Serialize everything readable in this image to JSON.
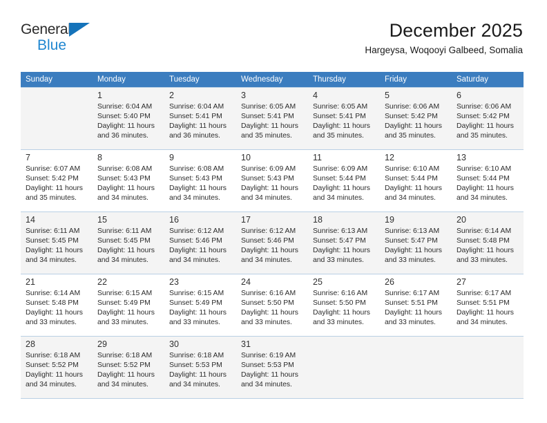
{
  "brand": {
    "name_part1": "General",
    "name_part2": "Blue",
    "accent_color": "#1f86d0",
    "triangle_color": "#1573ba"
  },
  "header": {
    "title": "December 2025",
    "subtitle": "Hargeysa, Woqooyi Galbeed, Somalia"
  },
  "calendar": {
    "header_bg": "#3b7dbf",
    "weekdays": [
      "Sunday",
      "Monday",
      "Tuesday",
      "Wednesday",
      "Thursday",
      "Friday",
      "Saturday"
    ],
    "weeks": [
      [
        {
          "day": "",
          "sunrise": "",
          "sunset": "",
          "daylight_line1": "",
          "daylight_line2": ""
        },
        {
          "day": "1",
          "sunrise": "Sunrise: 6:04 AM",
          "sunset": "Sunset: 5:40 PM",
          "daylight_line1": "Daylight: 11 hours",
          "daylight_line2": "and 36 minutes."
        },
        {
          "day": "2",
          "sunrise": "Sunrise: 6:04 AM",
          "sunset": "Sunset: 5:41 PM",
          "daylight_line1": "Daylight: 11 hours",
          "daylight_line2": "and 36 minutes."
        },
        {
          "day": "3",
          "sunrise": "Sunrise: 6:05 AM",
          "sunset": "Sunset: 5:41 PM",
          "daylight_line1": "Daylight: 11 hours",
          "daylight_line2": "and 35 minutes."
        },
        {
          "day": "4",
          "sunrise": "Sunrise: 6:05 AM",
          "sunset": "Sunset: 5:41 PM",
          "daylight_line1": "Daylight: 11 hours",
          "daylight_line2": "and 35 minutes."
        },
        {
          "day": "5",
          "sunrise": "Sunrise: 6:06 AM",
          "sunset": "Sunset: 5:42 PM",
          "daylight_line1": "Daylight: 11 hours",
          "daylight_line2": "and 35 minutes."
        },
        {
          "day": "6",
          "sunrise": "Sunrise: 6:06 AM",
          "sunset": "Sunset: 5:42 PM",
          "daylight_line1": "Daylight: 11 hours",
          "daylight_line2": "and 35 minutes."
        }
      ],
      [
        {
          "day": "7",
          "sunrise": "Sunrise: 6:07 AM",
          "sunset": "Sunset: 5:42 PM",
          "daylight_line1": "Daylight: 11 hours",
          "daylight_line2": "and 35 minutes."
        },
        {
          "day": "8",
          "sunrise": "Sunrise: 6:08 AM",
          "sunset": "Sunset: 5:43 PM",
          "daylight_line1": "Daylight: 11 hours",
          "daylight_line2": "and 34 minutes."
        },
        {
          "day": "9",
          "sunrise": "Sunrise: 6:08 AM",
          "sunset": "Sunset: 5:43 PM",
          "daylight_line1": "Daylight: 11 hours",
          "daylight_line2": "and 34 minutes."
        },
        {
          "day": "10",
          "sunrise": "Sunrise: 6:09 AM",
          "sunset": "Sunset: 5:43 PM",
          "daylight_line1": "Daylight: 11 hours",
          "daylight_line2": "and 34 minutes."
        },
        {
          "day": "11",
          "sunrise": "Sunrise: 6:09 AM",
          "sunset": "Sunset: 5:44 PM",
          "daylight_line1": "Daylight: 11 hours",
          "daylight_line2": "and 34 minutes."
        },
        {
          "day": "12",
          "sunrise": "Sunrise: 6:10 AM",
          "sunset": "Sunset: 5:44 PM",
          "daylight_line1": "Daylight: 11 hours",
          "daylight_line2": "and 34 minutes."
        },
        {
          "day": "13",
          "sunrise": "Sunrise: 6:10 AM",
          "sunset": "Sunset: 5:44 PM",
          "daylight_line1": "Daylight: 11 hours",
          "daylight_line2": "and 34 minutes."
        }
      ],
      [
        {
          "day": "14",
          "sunrise": "Sunrise: 6:11 AM",
          "sunset": "Sunset: 5:45 PM",
          "daylight_line1": "Daylight: 11 hours",
          "daylight_line2": "and 34 minutes."
        },
        {
          "day": "15",
          "sunrise": "Sunrise: 6:11 AM",
          "sunset": "Sunset: 5:45 PM",
          "daylight_line1": "Daylight: 11 hours",
          "daylight_line2": "and 34 minutes."
        },
        {
          "day": "16",
          "sunrise": "Sunrise: 6:12 AM",
          "sunset": "Sunset: 5:46 PM",
          "daylight_line1": "Daylight: 11 hours",
          "daylight_line2": "and 34 minutes."
        },
        {
          "day": "17",
          "sunrise": "Sunrise: 6:12 AM",
          "sunset": "Sunset: 5:46 PM",
          "daylight_line1": "Daylight: 11 hours",
          "daylight_line2": "and 34 minutes."
        },
        {
          "day": "18",
          "sunrise": "Sunrise: 6:13 AM",
          "sunset": "Sunset: 5:47 PM",
          "daylight_line1": "Daylight: 11 hours",
          "daylight_line2": "and 33 minutes."
        },
        {
          "day": "19",
          "sunrise": "Sunrise: 6:13 AM",
          "sunset": "Sunset: 5:47 PM",
          "daylight_line1": "Daylight: 11 hours",
          "daylight_line2": "and 33 minutes."
        },
        {
          "day": "20",
          "sunrise": "Sunrise: 6:14 AM",
          "sunset": "Sunset: 5:48 PM",
          "daylight_line1": "Daylight: 11 hours",
          "daylight_line2": "and 33 minutes."
        }
      ],
      [
        {
          "day": "21",
          "sunrise": "Sunrise: 6:14 AM",
          "sunset": "Sunset: 5:48 PM",
          "daylight_line1": "Daylight: 11 hours",
          "daylight_line2": "and 33 minutes."
        },
        {
          "day": "22",
          "sunrise": "Sunrise: 6:15 AM",
          "sunset": "Sunset: 5:49 PM",
          "daylight_line1": "Daylight: 11 hours",
          "daylight_line2": "and 33 minutes."
        },
        {
          "day": "23",
          "sunrise": "Sunrise: 6:15 AM",
          "sunset": "Sunset: 5:49 PM",
          "daylight_line1": "Daylight: 11 hours",
          "daylight_line2": "and 33 minutes."
        },
        {
          "day": "24",
          "sunrise": "Sunrise: 6:16 AM",
          "sunset": "Sunset: 5:50 PM",
          "daylight_line1": "Daylight: 11 hours",
          "daylight_line2": "and 33 minutes."
        },
        {
          "day": "25",
          "sunrise": "Sunrise: 6:16 AM",
          "sunset": "Sunset: 5:50 PM",
          "daylight_line1": "Daylight: 11 hours",
          "daylight_line2": "and 33 minutes."
        },
        {
          "day": "26",
          "sunrise": "Sunrise: 6:17 AM",
          "sunset": "Sunset: 5:51 PM",
          "daylight_line1": "Daylight: 11 hours",
          "daylight_line2": "and 33 minutes."
        },
        {
          "day": "27",
          "sunrise": "Sunrise: 6:17 AM",
          "sunset": "Sunset: 5:51 PM",
          "daylight_line1": "Daylight: 11 hours",
          "daylight_line2": "and 34 minutes."
        }
      ],
      [
        {
          "day": "28",
          "sunrise": "Sunrise: 6:18 AM",
          "sunset": "Sunset: 5:52 PM",
          "daylight_line1": "Daylight: 11 hours",
          "daylight_line2": "and 34 minutes."
        },
        {
          "day": "29",
          "sunrise": "Sunrise: 6:18 AM",
          "sunset": "Sunset: 5:52 PM",
          "daylight_line1": "Daylight: 11 hours",
          "daylight_line2": "and 34 minutes."
        },
        {
          "day": "30",
          "sunrise": "Sunrise: 6:18 AM",
          "sunset": "Sunset: 5:53 PM",
          "daylight_line1": "Daylight: 11 hours",
          "daylight_line2": "and 34 minutes."
        },
        {
          "day": "31",
          "sunrise": "Sunrise: 6:19 AM",
          "sunset": "Sunset: 5:53 PM",
          "daylight_line1": "Daylight: 11 hours",
          "daylight_line2": "and 34 minutes."
        },
        {
          "day": "",
          "sunrise": "",
          "sunset": "",
          "daylight_line1": "",
          "daylight_line2": ""
        },
        {
          "day": "",
          "sunrise": "",
          "sunset": "",
          "daylight_line1": "",
          "daylight_line2": ""
        },
        {
          "day": "",
          "sunrise": "",
          "sunset": "",
          "daylight_line1": "",
          "daylight_line2": ""
        }
      ]
    ]
  }
}
